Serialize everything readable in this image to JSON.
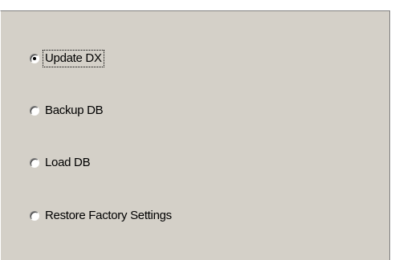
{
  "options": [
    {
      "label": "Update DX",
      "selected": true,
      "focused": true
    },
    {
      "label": "Backup DB",
      "selected": false,
      "focused": false
    },
    {
      "label": "Load DB",
      "selected": false,
      "focused": false
    },
    {
      "label": "Restore Factory Settings",
      "selected": false,
      "focused": false
    }
  ],
  "colors": {
    "panel_background": "#d4d0c8",
    "page_background": "#ffffff",
    "text": "#000000"
  },
  "icons": {
    "radio_selected": "radio-selected-icon",
    "radio_unselected": "radio-unselected-icon"
  }
}
